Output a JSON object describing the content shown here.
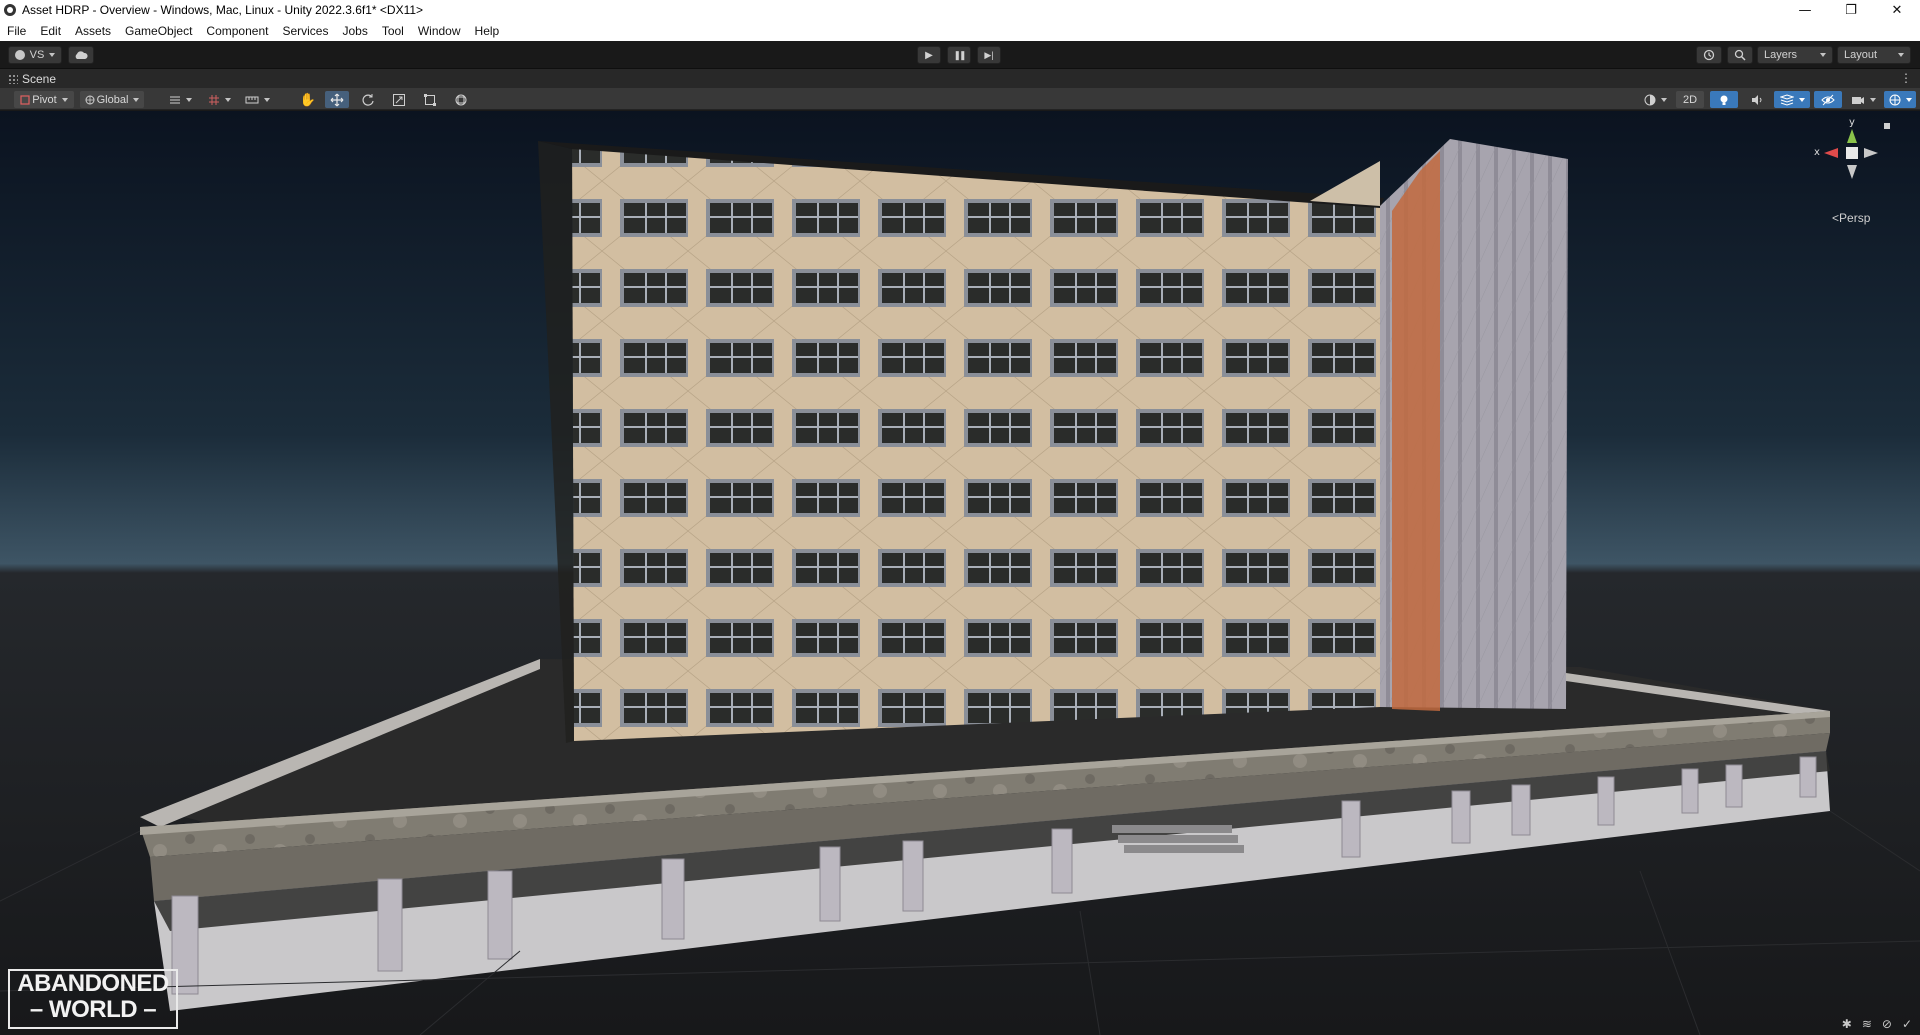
{
  "window": {
    "title": "Asset HDRP - Overview - Windows, Mac, Linux - Unity 2022.3.6f1* <DX11>",
    "minimize": "—",
    "restore": "❐",
    "close": "✕"
  },
  "menu": [
    "File",
    "Edit",
    "Assets",
    "GameObject",
    "Component",
    "Services",
    "Jobs",
    "Tool",
    "Window",
    "Help"
  ],
  "toolbar": {
    "account_label": "VS",
    "play": "▶",
    "pause": "❚❚",
    "step": "▶|",
    "layers_label": "Layers",
    "layout_label": "Layout"
  },
  "scene_tab": {
    "label": "Scene",
    "menu_icon": "⋮"
  },
  "scene_toolbar": {
    "pivot_label": "Pivot",
    "global_label": "Global",
    "mode_2d_label": "2D"
  },
  "gizmo": {
    "x_label": "x",
    "y_label": "y",
    "projection_label": "Persp"
  },
  "logo": {
    "line1": "ABANDONED",
    "line2": "WORLD"
  },
  "colors": {
    "accent": "#3a79bb",
    "sky_top": "#0c1420",
    "sky_horizon": "#3f5566",
    "ground": "#1e1f21"
  }
}
